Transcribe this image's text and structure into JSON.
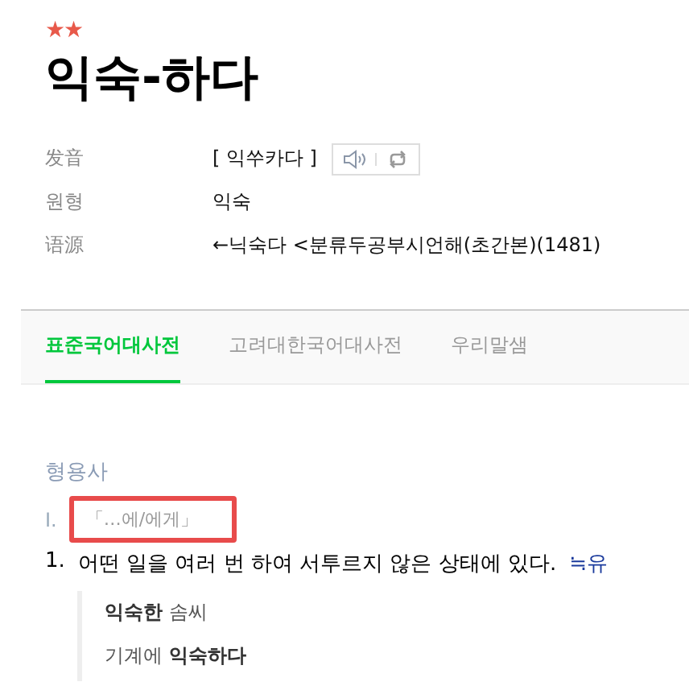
{
  "entry": {
    "importance": "★★",
    "headword": "익숙-하다"
  },
  "info": [
    {
      "kind": "pron",
      "label": "发音",
      "value": "[ 익쑤카다 ]"
    },
    {
      "kind": "text",
      "label": "원형",
      "value": "익숙"
    },
    {
      "kind": "text",
      "label": "语源",
      "value": "←닉숙다 <분류두공부시언해(초간본)(1481)"
    }
  ],
  "tabs": [
    {
      "label": "표준국어대사전",
      "selected": true
    },
    {
      "label": "고려대한국어대사전",
      "selected": false
    },
    {
      "label": "우리말샘",
      "selected": false
    }
  ],
  "sense": {
    "part_of_speech": "형용사",
    "number": "I.",
    "pattern": "「…에/에게」",
    "highlighted": true,
    "definitions": [
      {
        "number": "1.",
        "text": "어떤 일을 여러 번 하여 서투르지 않은 상태에 있다.",
        "synonym": "≒유",
        "examples": [
          "**익숙한** 솜씨",
          "기계에 **익숙하다**"
        ]
      }
    ]
  }
}
